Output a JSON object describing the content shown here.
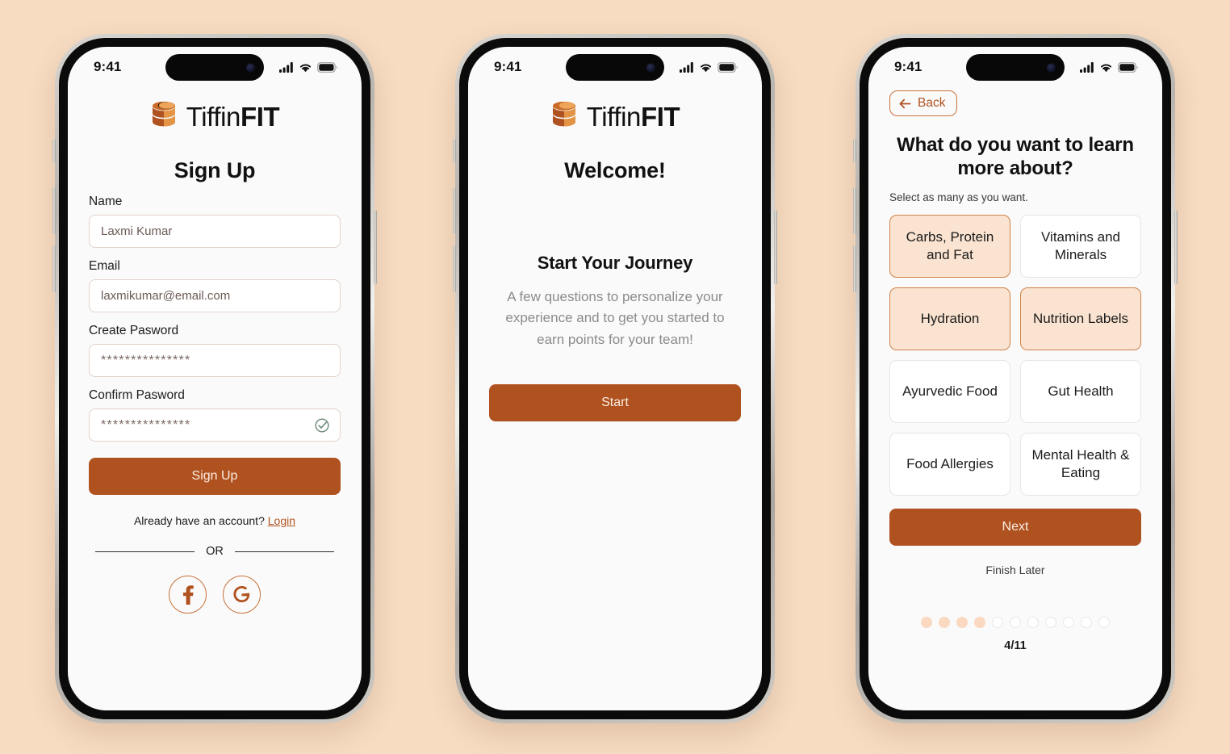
{
  "theme": {
    "background": "#F7DCC2",
    "accent": "#B0521F",
    "accent_light": "#C8733C",
    "selected_fill": "#FAE3D0",
    "screen_bg": "#FAFAFA",
    "check_green": "#6E8B79"
  },
  "brand": {
    "name_light": "Tiffin",
    "name_bold": "FIT",
    "logo_icon": "tiffin-stacked-container-icon"
  },
  "status_bar": {
    "time": "9:41",
    "cellular_icon": "cellular-signal-icon",
    "wifi_icon": "wifi-icon",
    "battery_icon": "battery-full-icon"
  },
  "screens": [
    {
      "id": "signup",
      "title": "Sign Up",
      "fields": [
        {
          "label": "Name",
          "value": "Laxmi Kumar",
          "type": "text",
          "verified": false
        },
        {
          "label": "Email",
          "value": "laxmikumar@email.com",
          "type": "email",
          "verified": false
        },
        {
          "label": "Create Pasword",
          "value": "***************",
          "type": "password",
          "verified": false
        },
        {
          "label": "Confirm Pasword",
          "value": "***************",
          "type": "password",
          "verified": true
        }
      ],
      "submit_label": "Sign Up",
      "login_prompt": "Already have an account?",
      "login_link": "Login",
      "divider_label": "OR",
      "social": [
        {
          "name": "facebook-icon",
          "glyph": "f"
        },
        {
          "name": "google-icon",
          "glyph": "G"
        }
      ]
    },
    {
      "id": "welcome",
      "title": "Welcome!",
      "subtitle": "Start Your Journey",
      "description": "A few questions to personalize your experience and to get you started to earn points for your team!",
      "cta_label": "Start"
    },
    {
      "id": "interests",
      "back_label": "Back",
      "back_icon": "arrow-left-icon",
      "question": "What do you want to learn more about?",
      "hint": "Select as many as you want.",
      "options": [
        {
          "label": "Carbs, Protein and Fat",
          "selected": true
        },
        {
          "label": "Vitamins and Minerals",
          "selected": false
        },
        {
          "label": "Hydration",
          "selected": true
        },
        {
          "label": "Nutrition Labels",
          "selected": true
        },
        {
          "label": "Ayurvedic Food",
          "selected": false
        },
        {
          "label": "Gut Health",
          "selected": false
        },
        {
          "label": "Food Allergies",
          "selected": false
        },
        {
          "label": "Mental Health & Eating",
          "selected": false
        }
      ],
      "next_label": "Next",
      "finish_later_label": "Finish Later",
      "progress": {
        "current": 4,
        "total": 11,
        "label": "4/11"
      }
    }
  ]
}
